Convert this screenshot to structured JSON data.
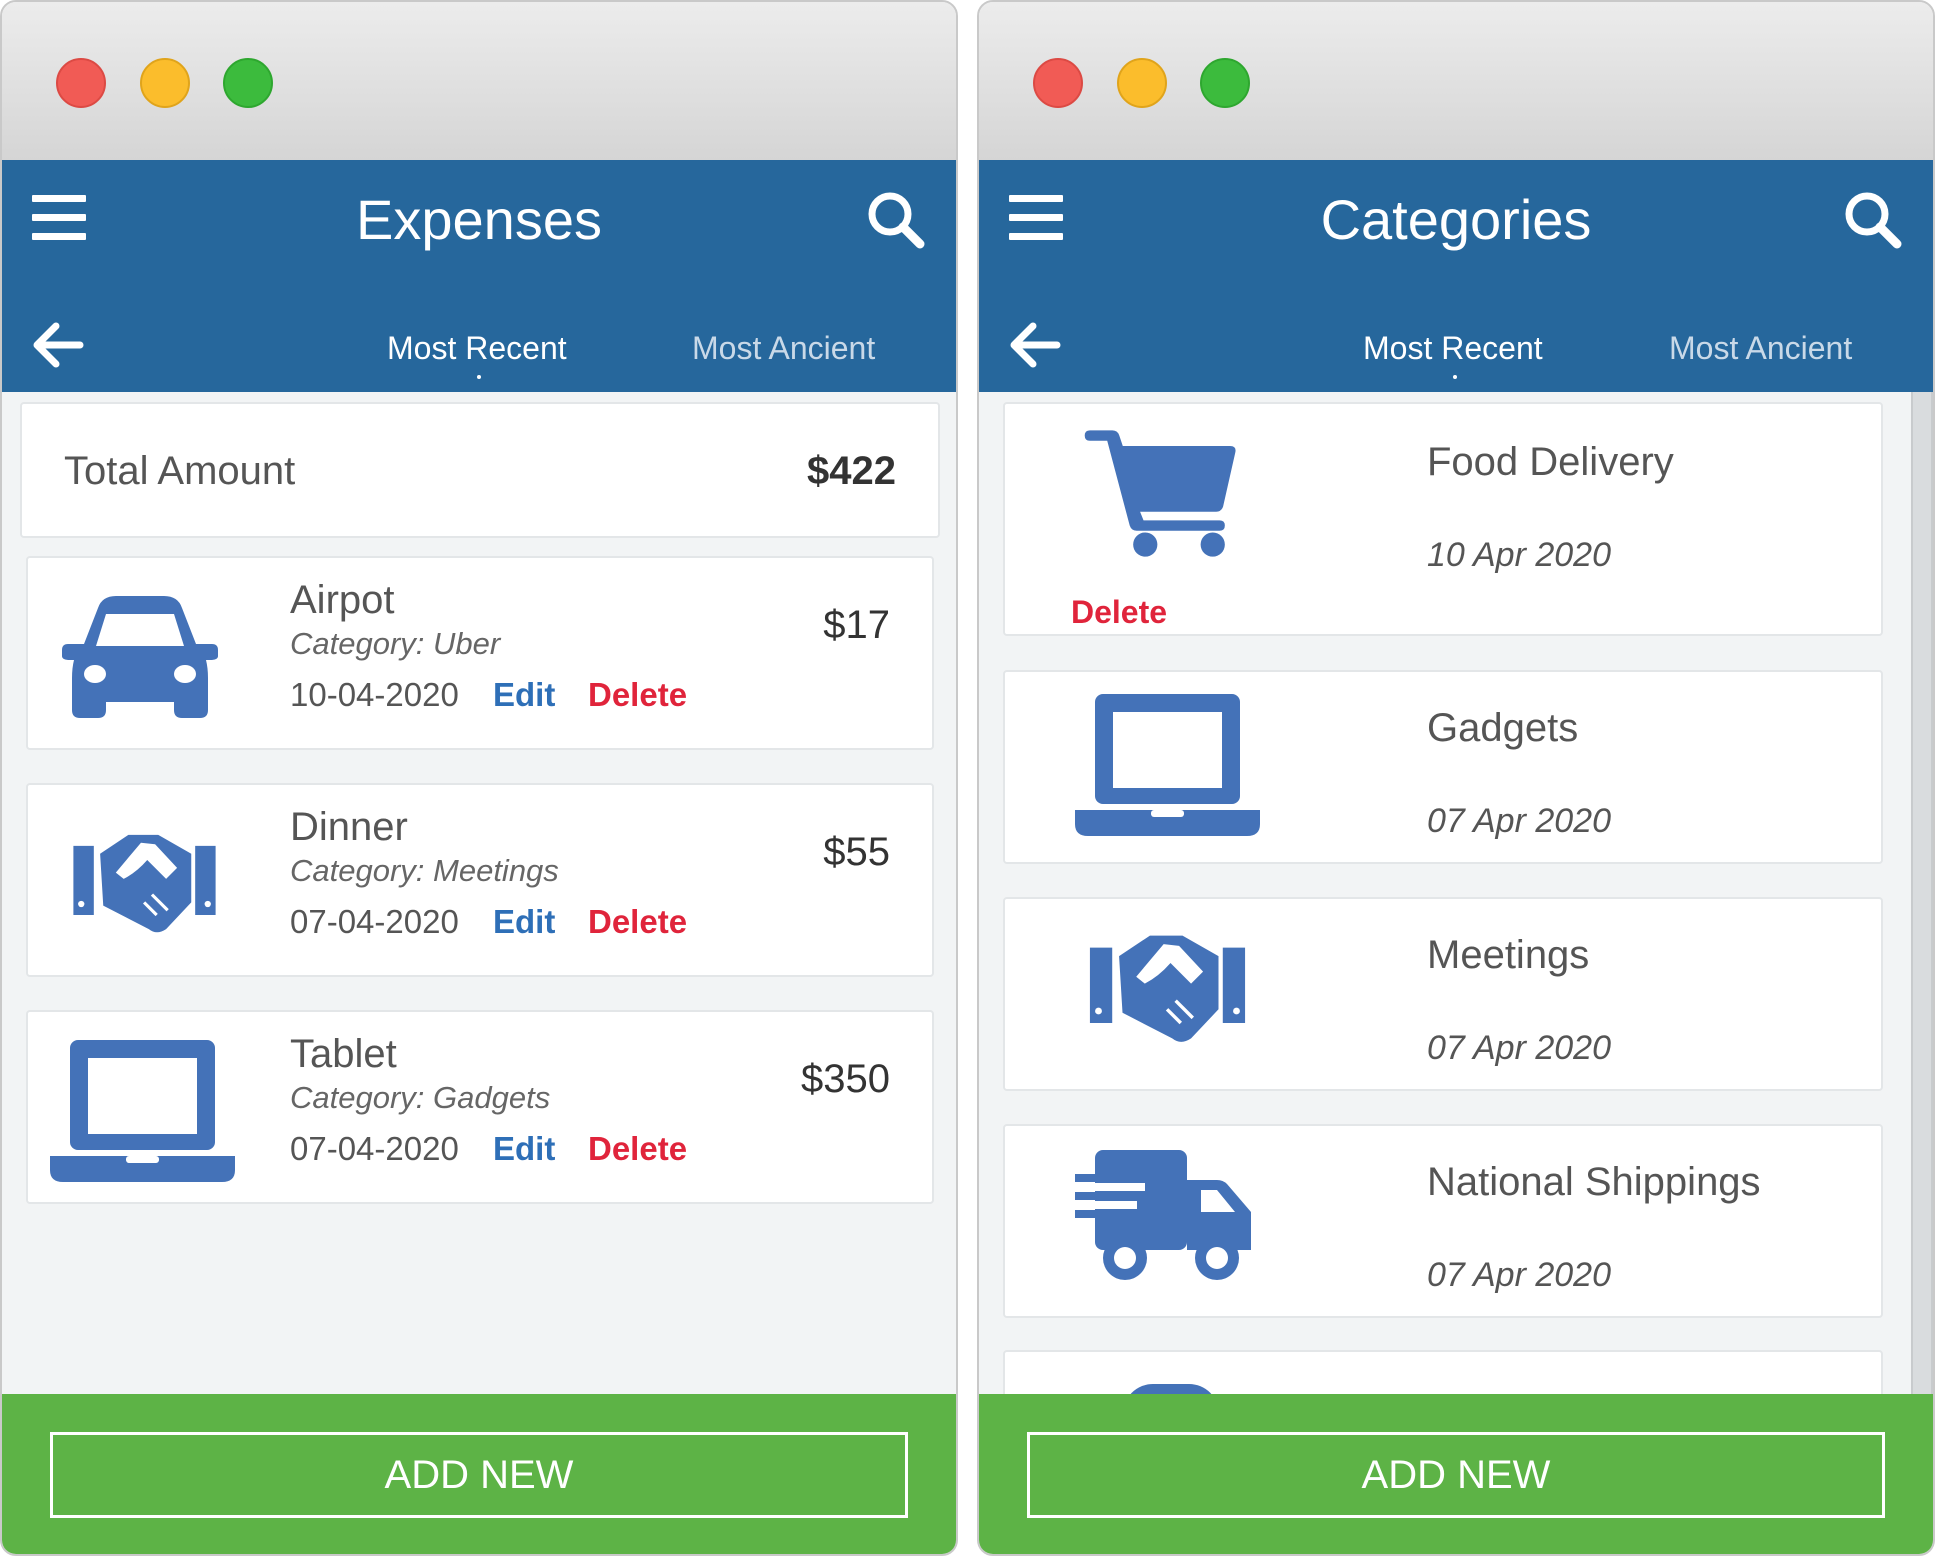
{
  "colors": {
    "appbar": "#26679c",
    "icon": "#4472b8",
    "delete": "#e0243b",
    "edit": "#2e6fb7",
    "footer": "#5db346"
  },
  "expenses_window": {
    "title": "Expenses",
    "tabs": [
      {
        "label": "Most Recent",
        "active": true
      },
      {
        "label": "Most Ancient",
        "active": false
      }
    ],
    "total": {
      "label": "Total Amount",
      "value": "$422"
    },
    "items": [
      {
        "title": "Airpot",
        "category": "Category: Uber",
        "date": "10-04-2020",
        "edit": "Edit",
        "delete": "Delete",
        "amount": "$17",
        "icon": "car-icon"
      },
      {
        "title": "Dinner",
        "category": "Category: Meetings",
        "date": "07-04-2020",
        "edit": "Edit",
        "delete": "Delete",
        "amount": "$55",
        "icon": "handshake-icon"
      },
      {
        "title": "Tablet",
        "category": "Category: Gadgets",
        "date": "07-04-2020",
        "edit": "Edit",
        "delete": "Delete",
        "amount": "$350",
        "icon": "laptop-icon"
      }
    ],
    "add_button": "ADD NEW"
  },
  "categories_window": {
    "title": "Categories",
    "tabs": [
      {
        "label": "Most Recent",
        "active": true
      },
      {
        "label": "Most Ancient",
        "active": false
      }
    ],
    "items": [
      {
        "name": "Food Delivery",
        "date": "10 Apr 2020",
        "delete": "Delete",
        "icon": "shopping-cart-icon"
      },
      {
        "name": "Gadgets",
        "date": "07 Apr 2020",
        "icon": "laptop-icon"
      },
      {
        "name": "Meetings",
        "date": "07 Apr 2020",
        "icon": "handshake-icon"
      },
      {
        "name": "National Shippings",
        "date": "07 Apr 2020",
        "icon": "truck-icon"
      }
    ],
    "add_button": "ADD NEW"
  }
}
